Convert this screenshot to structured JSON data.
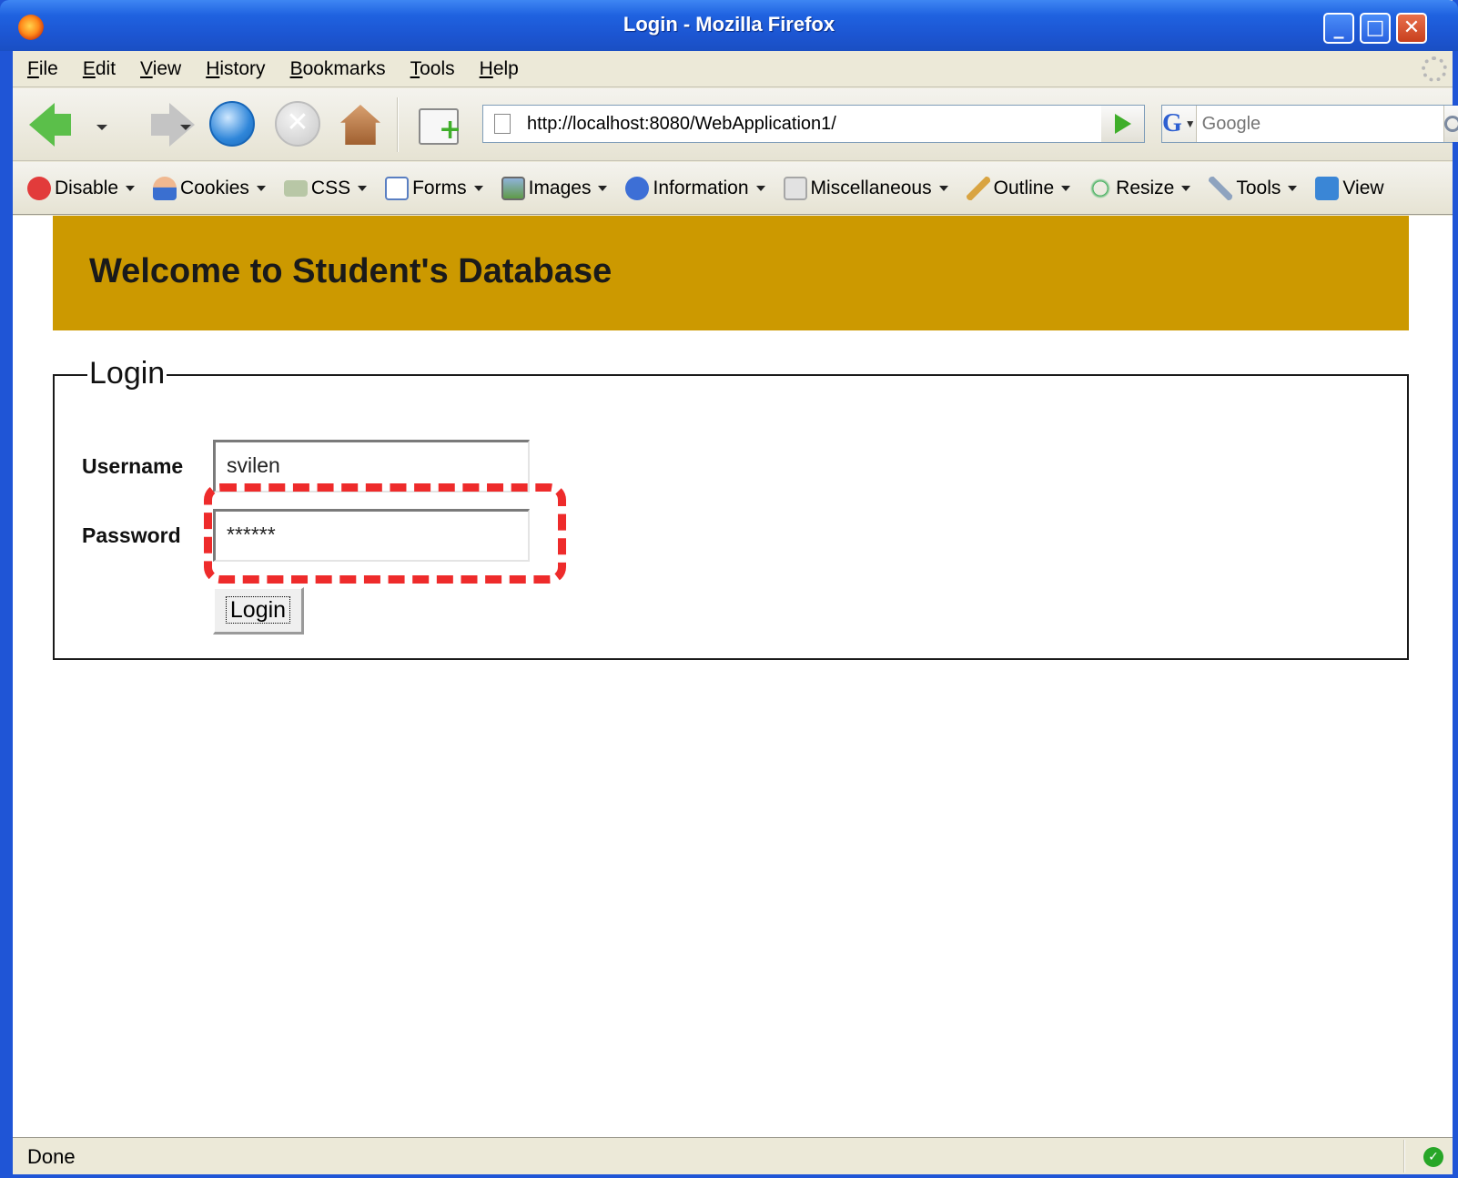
{
  "window": {
    "title": "Login - Mozilla Firefox"
  },
  "menubar": {
    "items": [
      "File",
      "Edit",
      "View",
      "History",
      "Bookmarks",
      "Tools",
      "Help"
    ]
  },
  "navbar": {
    "url": "http://localhost:8080/WebApplication1/",
    "search_placeholder": "Google"
  },
  "devbar": {
    "items": [
      "Disable",
      "Cookies",
      "CSS",
      "Forms",
      "Images",
      "Information",
      "Miscellaneous",
      "Outline",
      "Resize",
      "Tools",
      "View"
    ]
  },
  "page": {
    "banner_title": "Welcome to Student's Database",
    "legend": "Login",
    "username_label": "Username",
    "username_value": "svilen",
    "password_label": "Password",
    "password_value": "******",
    "login_button": "Login"
  },
  "status": {
    "text": "Done"
  },
  "colors": {
    "banner": "#cc9900",
    "highlight": "#ee2b2b",
    "titlebar": "#1f62e0"
  }
}
